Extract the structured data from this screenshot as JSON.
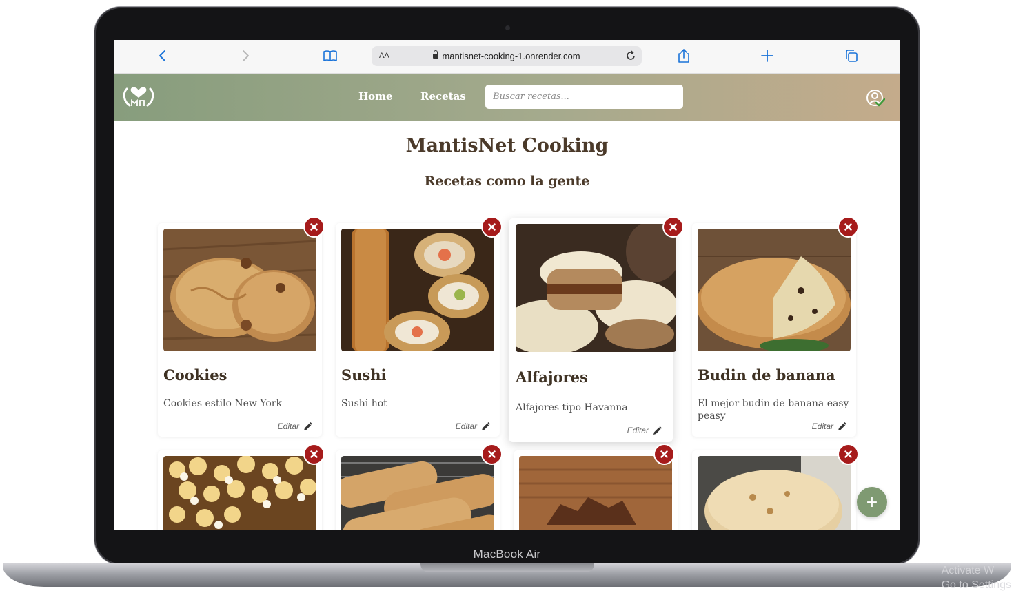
{
  "device": {
    "label": "MacBook Air"
  },
  "os_watermark": {
    "line1": "Activate W",
    "line2": "Go to Settings"
  },
  "browser": {
    "text_size_label": "AA",
    "url": "mantisnet-cooking-1.onrender.com",
    "icons": [
      "back-icon",
      "forward-icon",
      "bookmarks-icon",
      "lock-icon",
      "reload-icon",
      "share-icon",
      "new-tab-icon",
      "tabs-icon"
    ]
  },
  "navbar": {
    "links": [
      {
        "label": "Home"
      },
      {
        "label": "Recetas"
      }
    ],
    "search_placeholder": "Buscar recetas...",
    "icons": [
      "logo-icon",
      "user-verified-icon"
    ]
  },
  "page": {
    "title": "MantisNet Cooking",
    "subtitle": "Recetas como la gente"
  },
  "recipes": [
    {
      "title": "Cookies",
      "description": "Cookies estilo New York",
      "edit_label": "Editar"
    },
    {
      "title": "Sushi",
      "description": "Sushi hot",
      "edit_label": "Editar"
    },
    {
      "title": "Alfajores",
      "description": "Alfajores tipo Havanna",
      "edit_label": "Editar"
    },
    {
      "title": "Budin de banana",
      "description": "El mejor budin de banana easy peasy",
      "edit_label": "Editar"
    },
    {
      "title": "",
      "description": "",
      "edit_label": ""
    },
    {
      "title": "",
      "description": "",
      "edit_label": ""
    },
    {
      "title": "",
      "description": "",
      "edit_label": ""
    },
    {
      "title": "",
      "description": "",
      "edit_label": ""
    }
  ],
  "fab": {
    "label": "+"
  },
  "colors": {
    "navbar_start": "#879d7d",
    "navbar_end": "#c4ab8b",
    "delete": "#a61b1b",
    "fab": "#7f9a72",
    "title": "#4b3a2a"
  }
}
